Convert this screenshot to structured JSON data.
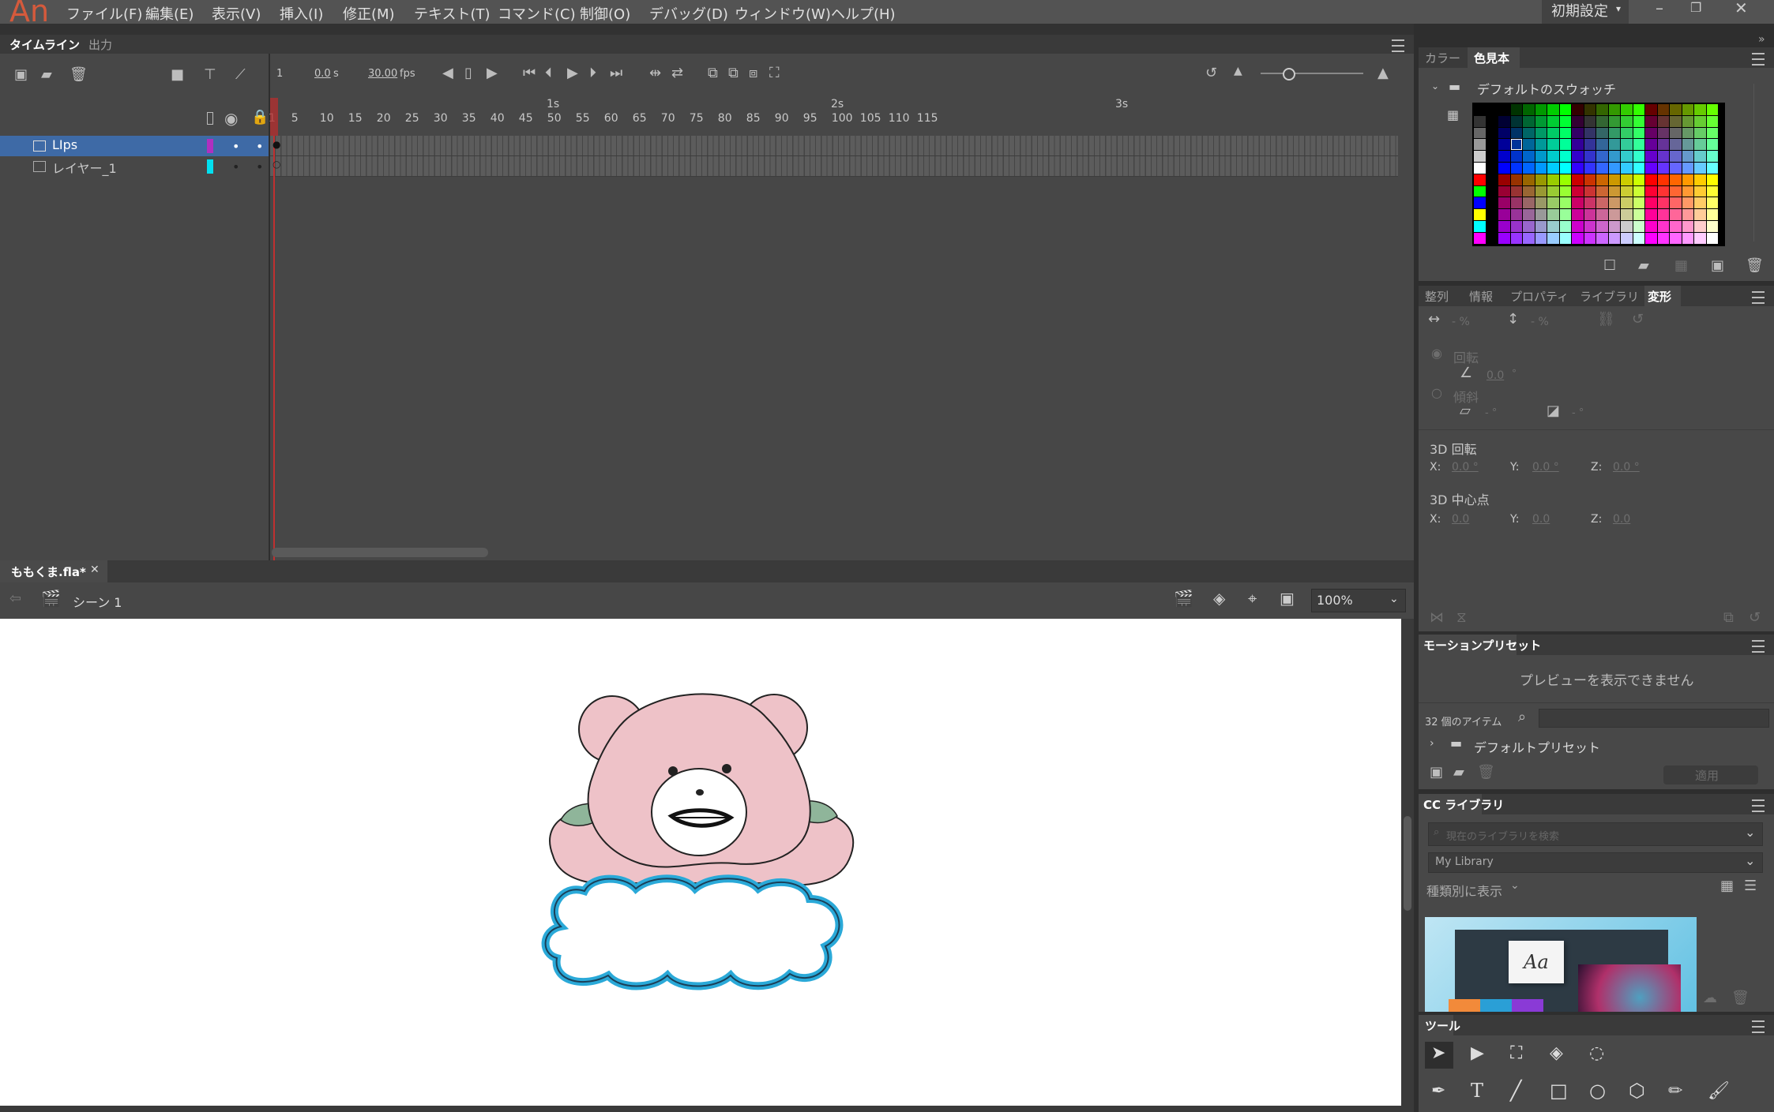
{
  "app": {
    "logo": "An",
    "workspace": "初期設定"
  },
  "menu": [
    "ファイル(F)",
    "編集(E)",
    "表示(V)",
    "挿入(I)",
    "修正(M)",
    "テキスト(T)",
    "コマンド(C)",
    "制御(O)",
    "デバッグ(D)",
    "ウィンドウ(W)",
    "ヘルプ(H)"
  ],
  "timeline": {
    "tabs": [
      "タイムライン",
      "出力"
    ],
    "current_frame": "1",
    "time": "0.0",
    "time_unit": "s",
    "fps": "30.00",
    "fps_unit": "fps",
    "seconds_markers": [
      "1s",
      "2s",
      "3s"
    ],
    "frame_numbers": [
      "1",
      "5",
      "10",
      "15",
      "20",
      "25",
      "30",
      "35",
      "40",
      "45",
      "50",
      "55",
      "60",
      "65",
      "70",
      "75",
      "80",
      "85",
      "90",
      "95",
      "100",
      "105",
      "110",
      "115"
    ],
    "layers": [
      {
        "name": "LIps",
        "color": "#b030c0",
        "selected": true
      },
      {
        "name": "レイヤー_1",
        "color": "#00e0f0",
        "selected": false
      }
    ]
  },
  "document": {
    "tab": "ももくま.fla*",
    "scene": "シーン 1",
    "zoom": "100%"
  },
  "color_panel": {
    "tabs": [
      "カラー",
      "色見本"
    ],
    "folder": "デフォルトのスウォッチ"
  },
  "transform_panel": {
    "tabs": [
      "整列",
      "情報",
      "プロパティ",
      "ライブラリ",
      "変形"
    ],
    "width_pct": "- %",
    "height_pct": "- %",
    "rotate_label": "回転",
    "rotate_value": "0.0",
    "rotate_unit": "°",
    "skew_label": "傾斜",
    "skew_h": "- °",
    "skew_v": "- °",
    "rot3d_label": "3D 回転",
    "rot3d": {
      "x": "0.0 °",
      "y": "0.0 °",
      "z": "0.0 °"
    },
    "center3d_label": "3D 中心点",
    "center3d": {
      "x": "0.0",
      "y": "0.0",
      "z": "0.0"
    },
    "axis": {
      "x": "X:",
      "y": "Y:",
      "z": "Z:"
    }
  },
  "motion_presets": {
    "title": "モーションプリセット",
    "preview": "プレビューを表示できません",
    "count": "32 個のアイテム",
    "folder": "デフォルトプリセット",
    "apply": "適用"
  },
  "cc_library": {
    "title": "CC ライブラリ",
    "search_placeholder": "現在のライブラリを検索",
    "library": "My Library",
    "view_by": "種類別に表示"
  },
  "tools": {
    "title": "ツール"
  }
}
